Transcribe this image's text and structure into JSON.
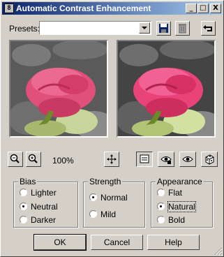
{
  "window": {
    "title": "Automatic Contrast Enhancement",
    "icon_letter": "8"
  },
  "titlebar_buttons": {
    "minimize": "_",
    "maximize": "□",
    "close": "X"
  },
  "presets": {
    "label": "Presets:",
    "value": ""
  },
  "zoom": {
    "level": "100%"
  },
  "bias": {
    "title": "Bias",
    "options": [
      "Lighter",
      "Neutral",
      "Darker"
    ],
    "selected": "Neutral"
  },
  "strength": {
    "title": "Strength",
    "options": [
      "Normal",
      "Mild"
    ],
    "selected": "Normal"
  },
  "appearance": {
    "title": "Appearance",
    "options": [
      "Flat",
      "Natural",
      "Bold"
    ],
    "selected": "Natural"
  },
  "buttons": {
    "ok": "OK",
    "cancel": "Cancel",
    "help": "Help"
  },
  "icons": [
    "app-icon",
    "save-preset-icon",
    "delete-preset-icon",
    "reset-icon",
    "zoom-out-icon",
    "zoom-in-icon",
    "pan-icon",
    "preview-toggle-icon",
    "proof-icon",
    "auto-proof-icon",
    "randomize-icon"
  ],
  "colors": {
    "title_start": "#0a246a",
    "title_end": "#a6caf0",
    "face": "#d4d0c8"
  }
}
